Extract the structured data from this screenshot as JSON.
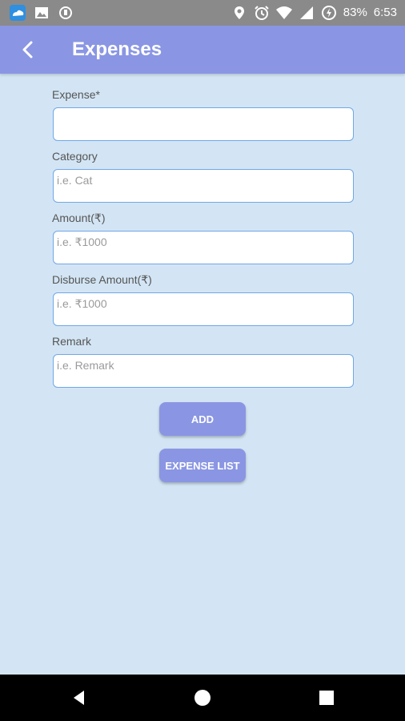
{
  "status_bar": {
    "battery": "83%",
    "time": "6:53",
    "left_icons": [
      "cloud-app-icon",
      "image-icon",
      "shield-icon"
    ],
    "right_icons": [
      "location-icon",
      "alarm-icon",
      "wifi-icon",
      "signal-icon",
      "battery-icon"
    ]
  },
  "app_bar": {
    "title": "Expenses",
    "back_icon": "chevron-left-icon",
    "color": "#8a96e3"
  },
  "form": {
    "fields": [
      {
        "label": "Expense*",
        "placeholder": "",
        "value": ""
      },
      {
        "label": "Category",
        "placeholder": "i.e. Cat",
        "value": ""
      },
      {
        "label": "Amount(₹)",
        "placeholder": "i.e. ₹1000",
        "value": ""
      },
      {
        "label": "Disburse Amount(₹)",
        "placeholder": "i.e. ₹1000",
        "value": ""
      },
      {
        "label": "Remark",
        "placeholder": "i.e. Remark",
        "value": ""
      }
    ]
  },
  "buttons": {
    "add": "ADD",
    "expense_list": "EXPENSE LIST"
  },
  "nav_bar": {
    "icons": [
      "back-triangle-icon",
      "home-circle-icon",
      "recents-square-icon"
    ]
  },
  "colors": {
    "background": "#d3e5f4",
    "accent": "#8a96e3",
    "input_border": "#6fa8e6"
  }
}
